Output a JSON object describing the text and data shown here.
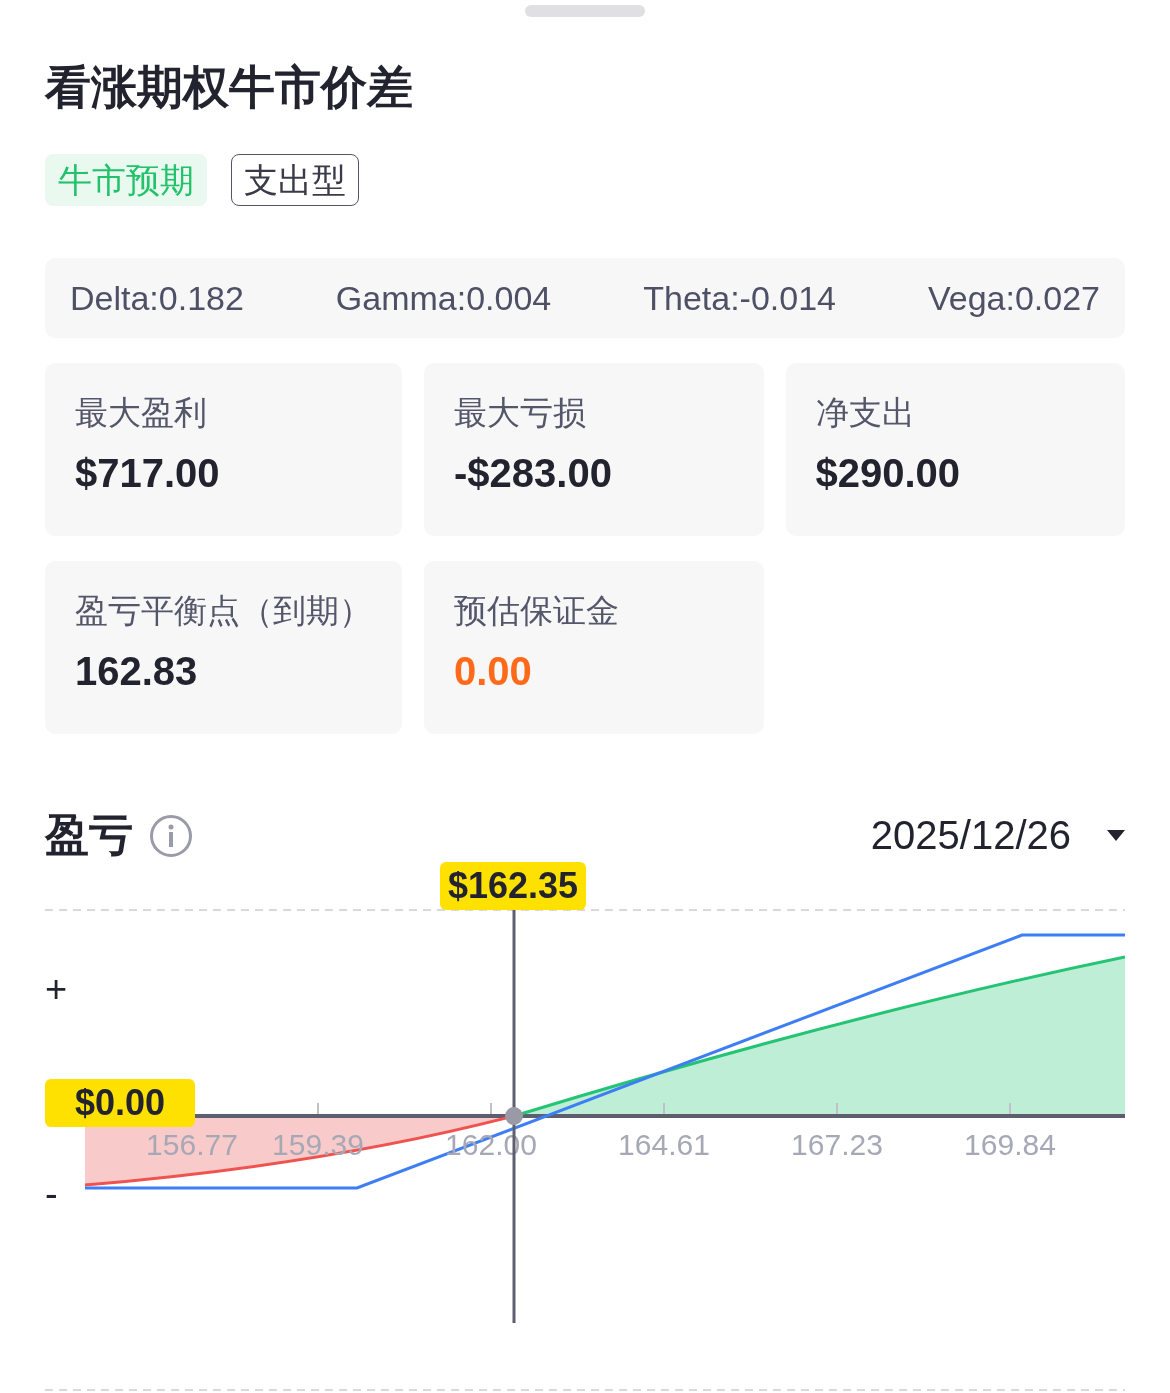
{
  "title": "看涨期权牛市价差",
  "tags": [
    {
      "label": "牛市预期",
      "kind": "filled"
    },
    {
      "label": "支出型",
      "kind": "outlined"
    }
  ],
  "greeks": [
    "Delta:0.182",
    "Gamma:0.004",
    "Theta:-0.014",
    "Vega:0.027"
  ],
  "metrics": [
    {
      "label": "最大盈利",
      "value": "$717.00",
      "color": "#23232f"
    },
    {
      "label": "最大亏损",
      "value": "-$283.00",
      "color": "#23232f"
    },
    {
      "label": "净支出",
      "value": "$290.00",
      "color": "#23232f"
    },
    {
      "label": "盈亏平衡点（到期）",
      "value": "162.83",
      "color": "#23232f"
    },
    {
      "label": "预估保证金",
      "value": "0.00",
      "color": "#ff6a1a"
    }
  ],
  "pnl": {
    "title": "盈亏",
    "date": "2025/12/26",
    "price_marker": "$162.35",
    "pnl_marker": "$0.00",
    "y_labels": [
      "+",
      "-"
    ],
    "x_labels": [
      "156.77",
      "159.39",
      "162.00",
      "164.61",
      "167.23",
      "169.84"
    ]
  }
}
